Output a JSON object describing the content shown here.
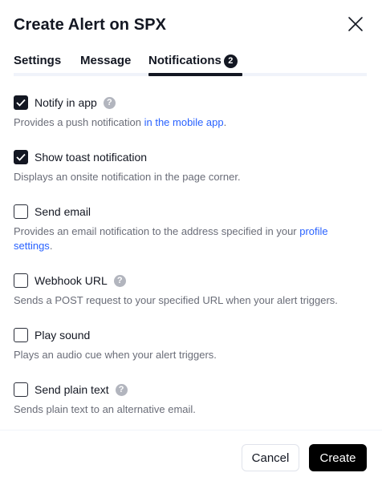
{
  "dialog": {
    "title": "Create Alert on SPX",
    "close_icon": "close-icon"
  },
  "tabs": [
    {
      "label": "Settings",
      "active": false
    },
    {
      "label": "Message",
      "active": false
    },
    {
      "label": "Notifications",
      "active": true,
      "badge": "2"
    }
  ],
  "options": [
    {
      "label": "Notify in app",
      "checked": true,
      "has_help": true,
      "description": "Provides a push notification ",
      "link": "in the mobile app",
      "description_suffix": "."
    },
    {
      "label": "Show toast notification",
      "checked": true,
      "has_help": false,
      "description": "Displays an onsite notification in the page corner."
    },
    {
      "label": "Send email",
      "checked": false,
      "has_help": false,
      "description": "Provides an email notification to the address specified in your ",
      "link": "profile settings",
      "description_suffix": "."
    },
    {
      "label": "Webhook URL",
      "checked": false,
      "has_help": true,
      "description": "Sends a POST request to your specified URL when your alert triggers."
    },
    {
      "label": "Play sound",
      "checked": false,
      "has_help": false,
      "description": "Plays an audio cue when your alert triggers."
    },
    {
      "label": "Send plain text",
      "checked": false,
      "has_help": true,
      "description": "Sends plain text to an alternative email."
    }
  ],
  "help_glyph": "?",
  "footer": {
    "cancel_label": "Cancel",
    "create_label": "Create"
  },
  "colors": {
    "accent_link": "#2962ff",
    "checkbox_checked": "#131722",
    "create_button": "#000000"
  }
}
